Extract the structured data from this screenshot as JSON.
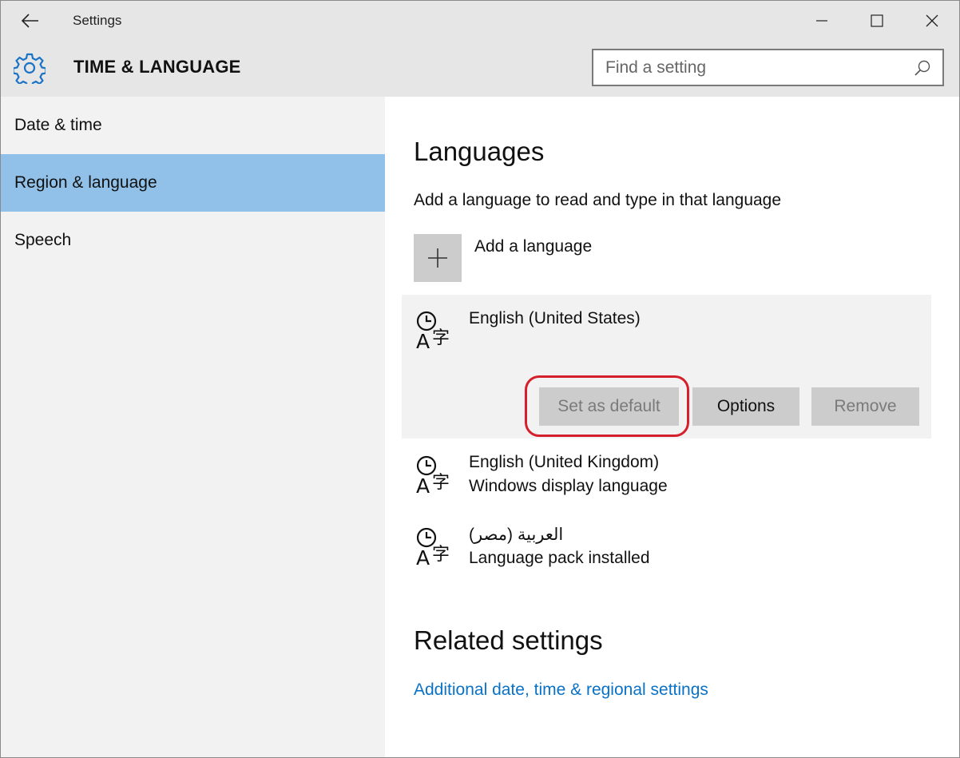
{
  "window": {
    "title": "Settings"
  },
  "header": {
    "title": "TIME & LANGUAGE"
  },
  "search": {
    "placeholder": "Find a setting"
  },
  "sidebar": {
    "items": [
      {
        "label": "Date & time",
        "active": false
      },
      {
        "label": "Region & language",
        "active": true
      },
      {
        "label": "Speech",
        "active": false
      }
    ]
  },
  "main": {
    "heading": "Languages",
    "subheading": "Add a language to read and type in that language",
    "add_language_label": "Add a language",
    "languages": [
      {
        "name": "English (United States)",
        "status": "",
        "selected": true
      },
      {
        "name": "English (United Kingdom)",
        "status": "Windows display language",
        "selected": false
      },
      {
        "name": "العربية (مصر)",
        "status": "Language pack installed",
        "selected": false
      }
    ],
    "buttons": {
      "set_default": "Set as default",
      "options": "Options",
      "remove": "Remove"
    },
    "related_heading": "Related settings",
    "related_link": "Additional date, time & regional settings"
  },
  "colors": {
    "accent": "#0a72c6",
    "sidebar_active": "#91c1e8",
    "highlight": "#d61f2c"
  }
}
